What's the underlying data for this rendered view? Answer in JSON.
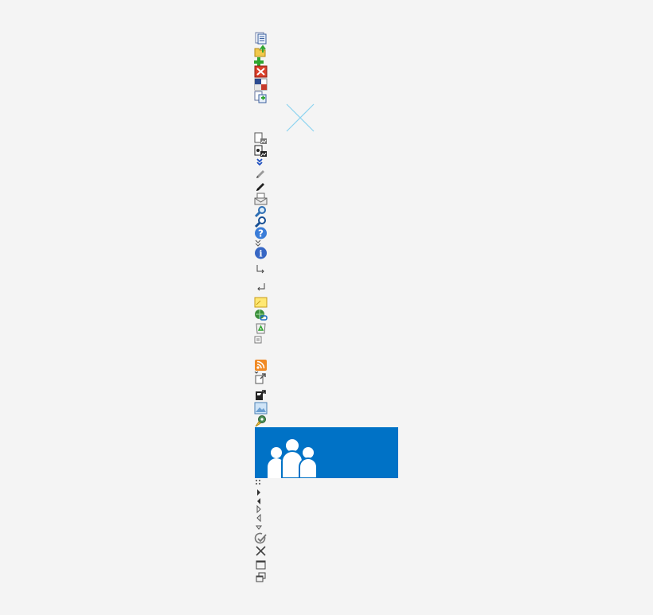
{
  "sprite_sheet": {
    "icons": [
      {
        "name": "new-document-icon"
      },
      {
        "name": "upload-document-icon"
      },
      {
        "name": "add-icon"
      },
      {
        "name": "delete-icon"
      },
      {
        "name": "flag-icon"
      },
      {
        "name": "copy-document-icon"
      },
      {
        "name": "broken-image-icon"
      },
      {
        "name": "document-settings-icon"
      },
      {
        "name": "document-settings-dark-icon"
      },
      {
        "name": "expand-double-chevron-icon"
      },
      {
        "name": "pencil-light-icon"
      },
      {
        "name": "pencil-dark-icon"
      },
      {
        "name": "email-document-icon"
      },
      {
        "name": "search-light-icon"
      },
      {
        "name": "search-dark-icon"
      },
      {
        "name": "help-icon"
      },
      {
        "name": "sort-arrow-icon"
      },
      {
        "name": "info-icon"
      },
      {
        "name": "indent-arrow-icon"
      },
      {
        "name": "return-arrow-icon"
      },
      {
        "name": "note-icon"
      },
      {
        "name": "web-link-icon"
      },
      {
        "name": "recycle-icon"
      },
      {
        "name": "small-square-icon"
      },
      {
        "name": "rss-icon"
      },
      {
        "name": "export-light-icon"
      },
      {
        "name": "export-dark-icon"
      },
      {
        "name": "image-icon"
      },
      {
        "name": "settings-gear-icon"
      },
      {
        "name": "people-group-icon"
      },
      {
        "name": "grip-dots-icon"
      },
      {
        "name": "arrow-right-filled-icon"
      },
      {
        "name": "arrow-left-filled-icon"
      },
      {
        "name": "arrow-right-outline-icon"
      },
      {
        "name": "arrow-left-outline-icon"
      },
      {
        "name": "arrow-down-outline-icon"
      },
      {
        "name": "check-circle-icon"
      },
      {
        "name": "close-icon"
      },
      {
        "name": "maximize-icon"
      },
      {
        "name": "restore-icon"
      }
    ]
  },
  "colors": {
    "background": "#f4f4f4",
    "banner": "#0072c6",
    "accent_blue": "#1e6fc0",
    "accent_green": "#2fa52f",
    "accent_red": "#d9402b",
    "accent_orange": "#f08a24",
    "icon_gray": "#555555"
  }
}
